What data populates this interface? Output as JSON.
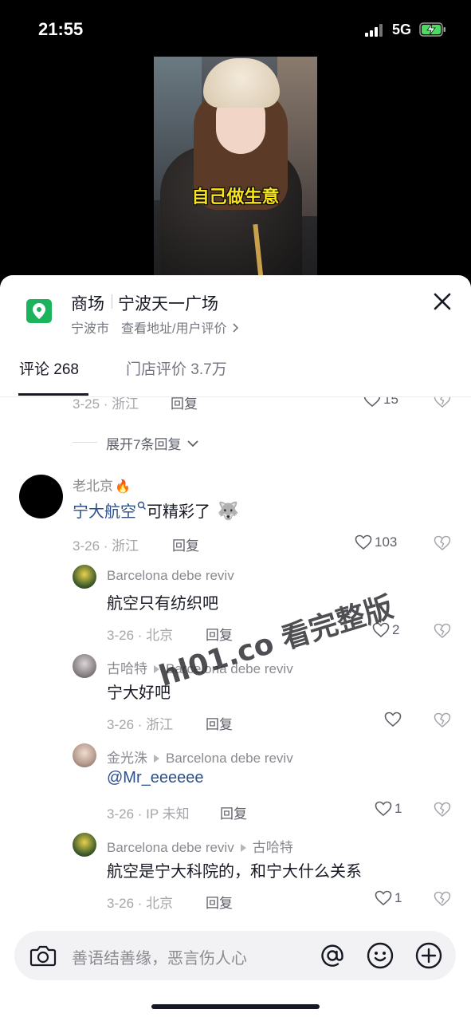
{
  "status_bar": {
    "time": "21:55",
    "network": "5G",
    "battery": "charging"
  },
  "video": {
    "caption": "自己做生意"
  },
  "poi": {
    "category": "商场",
    "name": "宁波天一广场",
    "city": "宁波市",
    "address_link": "查看地址/用户评价",
    "icon": "map-pin-icon",
    "accent_color": "#1bb35c"
  },
  "tabs": [
    {
      "label": "评论 268",
      "active": true
    },
    {
      "label": "门店评价 3.7万",
      "active": false
    }
  ],
  "partial_comment": {
    "meta": "3-25 · 浙江",
    "reply": "回复",
    "likes": "15"
  },
  "expand": {
    "label": "展开7条回复"
  },
  "comments": [
    {
      "username": "老北京",
      "badge": "🔥",
      "mention": "宁大航空",
      "text": "可精彩了",
      "emoji": "🐺",
      "meta": "3-26 · 浙江",
      "reply": "回复",
      "likes": "103"
    }
  ],
  "replies": [
    {
      "username": "Barcelona debe reviv",
      "reply_to": "",
      "text": "航空只有纺织吧",
      "meta": "3-26 · 北京",
      "reply": "回复",
      "likes": "2"
    },
    {
      "username": "古哈特",
      "reply_to": "Barcelona debe reviv",
      "text": "宁大好吧",
      "meta": "3-26 · 浙江",
      "reply": "回复",
      "likes": ""
    },
    {
      "username": "金光洙",
      "reply_to": "Barcelona debe reviv",
      "text": "@Mr_eeeeee",
      "meta": "3-26 · IP 未知",
      "reply": "回复",
      "likes": "1"
    },
    {
      "username": "Barcelona debe reviv",
      "reply_to": "古哈特",
      "text": "航空是宁大科院的，和宁大什么关系",
      "meta": "3-26 · 北京",
      "reply": "回复",
      "likes": "1"
    }
  ],
  "watermark": "hl01.co 看完整版",
  "input": {
    "placeholder": "善语结善缘，恶言伤人心"
  }
}
